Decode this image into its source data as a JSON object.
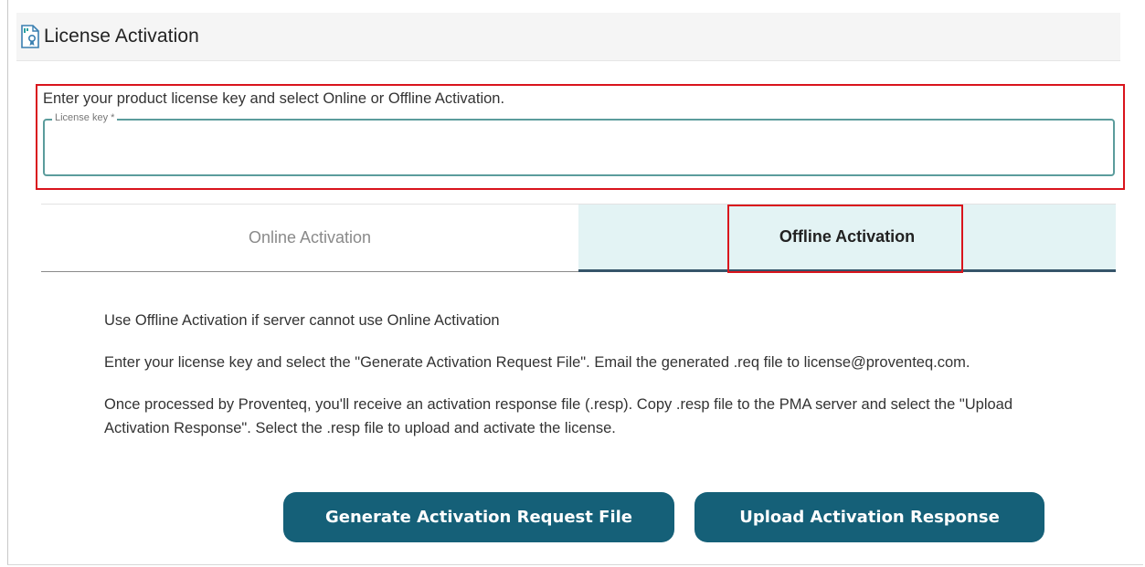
{
  "header": {
    "title": "License Activation",
    "icon": "license-certificate-icon"
  },
  "license": {
    "instruction": "Enter your product license key and select Online or Offline Activation.",
    "key_label": "License key *",
    "key_value": "",
    "key_placeholder": ""
  },
  "tabs": [
    {
      "label": "Online Activation",
      "active": false
    },
    {
      "label": "Offline Activation",
      "active": true
    }
  ],
  "offline": {
    "paragraphs": [
      "Use Offline Activation if server cannot use Online Activation",
      "Enter your license key and select the \"Generate Activation Request File\". Email the generated .req file to license@proventeq.com.",
      "Once processed by Proventeq, you'll receive an activation response file (.resp). Copy .resp file to the PMA server and select the \"Upload Activation Response\". Select the .resp file to upload and activate the license."
    ],
    "generate_button": "Generate Activation Request File",
    "upload_button": "Upload Activation Response"
  },
  "colors": {
    "button_bg": "#156078",
    "highlight_red": "#d9141c",
    "active_tab_bg": "#e3f3f4",
    "field_border": "#5b9c9c"
  }
}
